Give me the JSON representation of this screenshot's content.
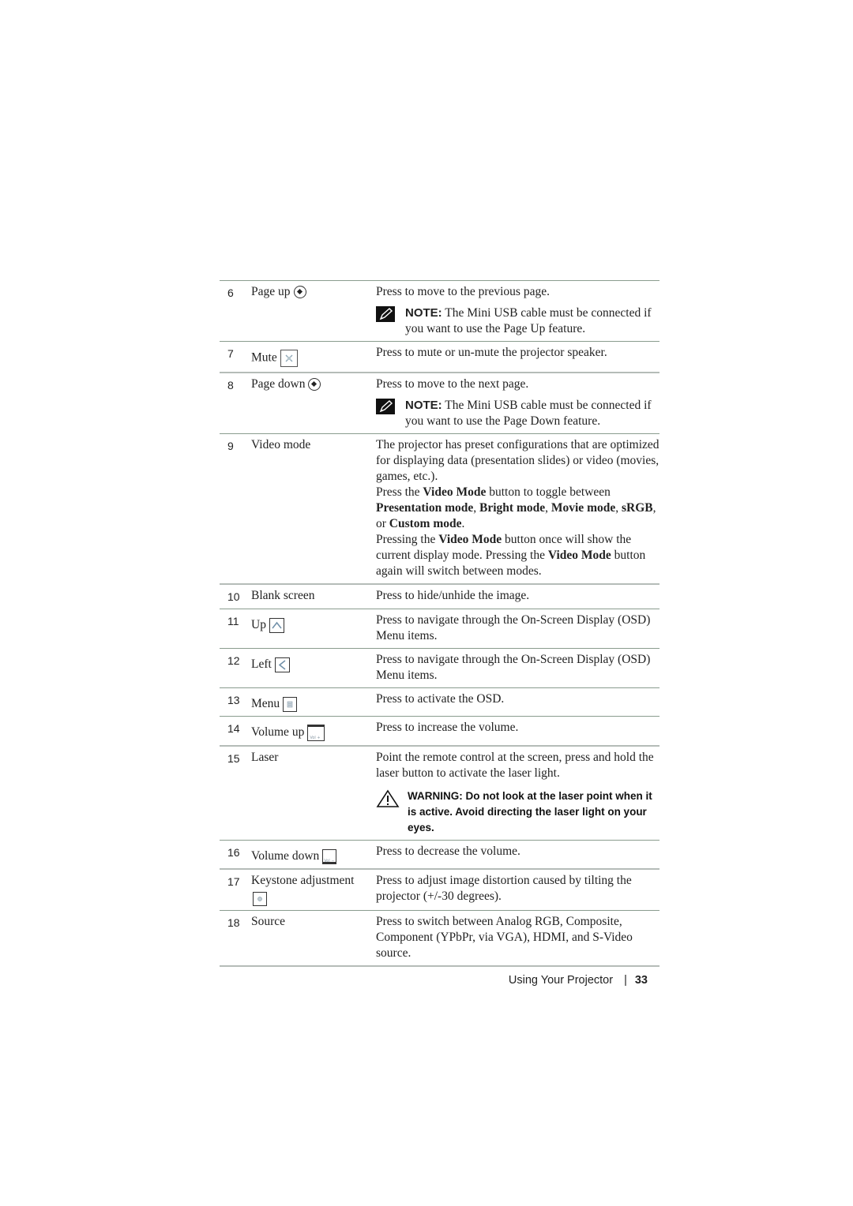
{
  "rows": [
    {
      "num": "6",
      "name": "Page up",
      "icon": "page-up-icon",
      "desc": "Press to move to the previous page.",
      "note": {
        "label": "NOTE:",
        "text": " The Mini USB cable must be connected if you want to use the Page Up feature."
      }
    },
    {
      "num": "7",
      "name": "Mute",
      "icon": "mute-icon",
      "desc": "Press to mute or un-mute the projector speaker."
    },
    {
      "num": "8",
      "name": "Page down",
      "icon": "page-down-icon",
      "desc": "Press to move to the next page.",
      "note": {
        "label": "NOTE:",
        "text": " The Mini USB cable must be connected if you want to use the Page Down feature."
      }
    },
    {
      "num": "9",
      "name": "Video mode",
      "desc_parts": {
        "p1": "The projector has preset configurations that are optimized for displaying data (presentation slides) or video (movies, games, etc.).",
        "p2a": "Press the ",
        "p2b": "Video Mode",
        "p2c": " button to toggle between ",
        "p2d": "Presentation mode",
        "p2e": ", ",
        "p2f": "Bright mode",
        "p2g": ", ",
        "p2h": "Movie mode",
        "p2i": ", ",
        "p2j": "sRGB",
        "p2k": ", or ",
        "p2l": "Custom mode",
        "p2m": ".",
        "p3a": "Pressing the ",
        "p3b": "Video Mode",
        "p3c": " button once will show the current display mode. Pressing the ",
        "p3d": "Video Mode",
        "p3e": " button again will switch between modes."
      }
    },
    {
      "num": "10",
      "name": "Blank screen",
      "desc": "Press to hide/unhide the image."
    },
    {
      "num": "11",
      "name": "Up",
      "icon": "up-arrow-icon",
      "desc": "Press to navigate through the On-Screen Display (OSD) Menu items."
    },
    {
      "num": "12",
      "name": "Left",
      "icon": "left-arrow-icon",
      "desc": "Press to navigate through the On-Screen Display (OSD) Menu items."
    },
    {
      "num": "13",
      "name": "Menu",
      "icon": "menu-icon",
      "desc": "Press to activate the OSD."
    },
    {
      "num": "14",
      "name": "Volume up",
      "icon": "volume-up-icon",
      "icon_text": "Vol +",
      "desc": "Press to increase the volume."
    },
    {
      "num": "15",
      "name": "Laser",
      "desc": "Point the remote control at the screen, press and hold the laser button to activate the laser light.",
      "warning": "WARNING: Do not look at the laser point when it is active. Avoid directing the laser light on your eyes."
    },
    {
      "num": "16",
      "name": "Volume down",
      "icon": "volume-down-icon",
      "icon_text": "Vol −",
      "desc": "Press to decrease the volume."
    },
    {
      "num": "17",
      "name": "Keystone adjustment",
      "icon": "keystone-icon",
      "desc": "Press to adjust image distortion caused by tilting the projector (+/-30 degrees)."
    },
    {
      "num": "18",
      "name": "Source",
      "desc": "Press to switch between Analog RGB, Composite, Component (YPbPr, via VGA), HDMI, and S-Video source."
    }
  ],
  "footer": {
    "section": "Using Your Projector",
    "separator": "|",
    "page": "33"
  }
}
